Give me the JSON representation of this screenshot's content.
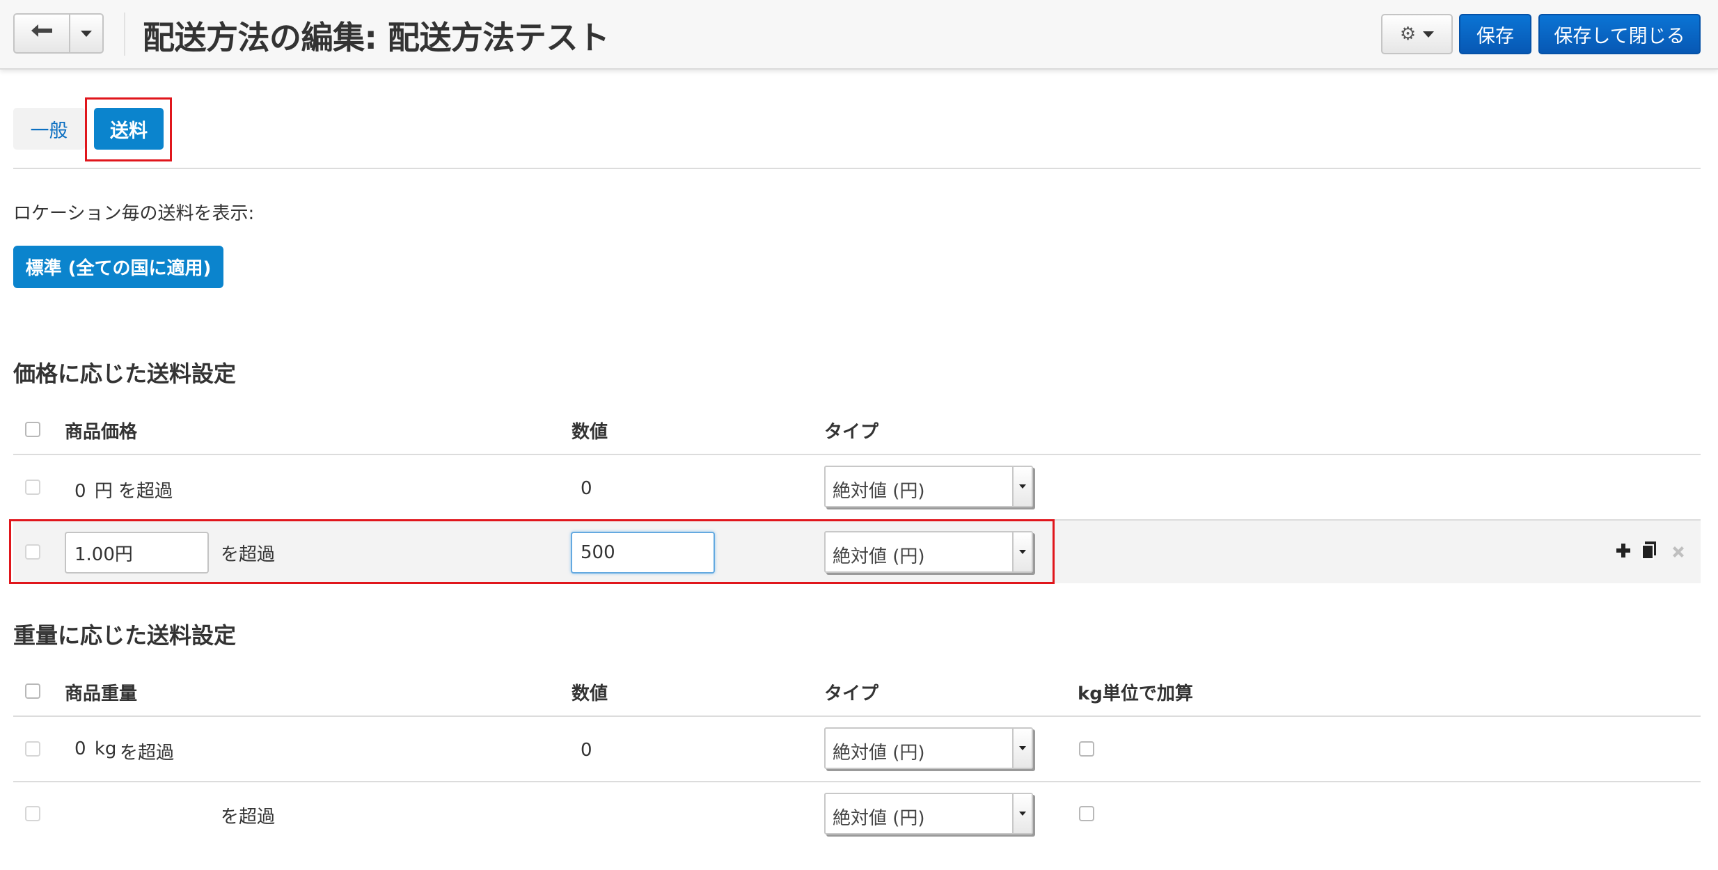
{
  "header": {
    "title": "配送方法の編集: 配送方法テスト",
    "save_label": "保存",
    "save_close_label": "保存して閉じる"
  },
  "tabs": [
    {
      "label": "一般"
    },
    {
      "label": "送料"
    }
  ],
  "location": {
    "label": "ロケーション毎の送料を表示:",
    "button_label": "標準 (全ての国に適用)"
  },
  "price_section": {
    "title": "価格に応じた送料設定",
    "columns": {
      "condition": "商品価格",
      "value": "数値",
      "type": "タイプ"
    },
    "rows": [
      {
        "amount": "0",
        "unit": "円",
        "suffix": "を超過",
        "value": "0",
        "type": "絶対値 (円)"
      },
      {
        "amount_input": "1.00円",
        "suffix": "を超過",
        "value_input": "500",
        "type": "絶対値 (円)"
      }
    ]
  },
  "weight_section": {
    "title": "重量に応じた送料設定",
    "columns": {
      "condition": "商品重量",
      "value": "数値",
      "type": "タイプ",
      "per_kg": "kg単位で加算"
    },
    "rows": [
      {
        "amount": "0",
        "unit": "kg",
        "suffix": "を超過",
        "value": "0",
        "type": "絶対値 (円)"
      },
      {
        "suffix": "を超過",
        "type": "絶対値 (円)"
      }
    ]
  },
  "colors": {
    "primary": "#0b84cd",
    "highlight_box": "#e0161c",
    "header_bg": "#f7f7f7"
  },
  "icons": [
    "back-arrow-icon",
    "chevron-down-icon",
    "gear-icon",
    "plus-icon",
    "copy-icon",
    "delete-icon"
  ]
}
